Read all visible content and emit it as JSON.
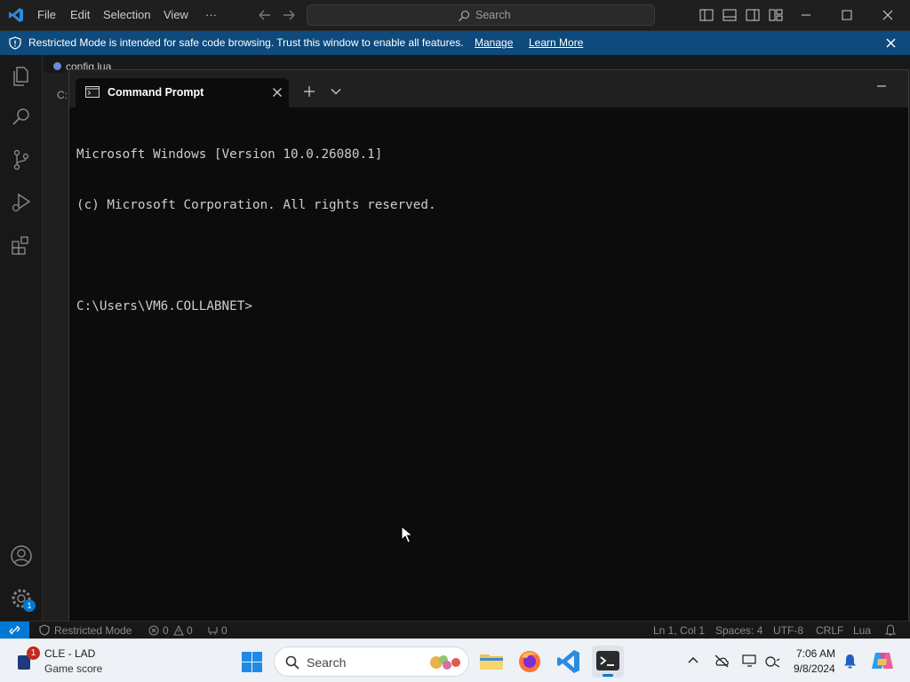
{
  "vscode": {
    "menu": [
      "File",
      "Edit",
      "Selection",
      "View",
      "···"
    ],
    "search_placeholder": "Search",
    "banner": {
      "message": "Restricted Mode is intended for safe code browsing. Trust this window to enable all features.",
      "manage": "Manage",
      "learn_more": "Learn More"
    },
    "editor_tab": "config.lua",
    "editor_crumb": "C:",
    "accounts_badge": "1"
  },
  "cmd": {
    "tab_title": "Command Prompt",
    "lines": [
      "Microsoft Windows [Version 10.0.26080.1]",
      "(c) Microsoft Corporation. All rights reserved.",
      "",
      "C:\\Users\\VM6.COLLABNET>"
    ]
  },
  "statusbar": {
    "restricted": "Restricted Mode",
    "errors": "0",
    "warnings": "0",
    "ports": "0",
    "position": "Ln 1, Col 1",
    "spaces": "Spaces: 4",
    "encoding": "UTF-8",
    "eol": "CRLF",
    "language": "Lua"
  },
  "taskbar": {
    "widget_title": "CLE - LAD",
    "widget_sub": "Game score",
    "widget_badge": "1",
    "search": "Search",
    "time": "7:06 AM",
    "date": "9/8/2024"
  },
  "colors": {
    "accent": "#0078d4",
    "banner": "#0e4a7c",
    "terminal_bg": "#0c0c0c"
  }
}
